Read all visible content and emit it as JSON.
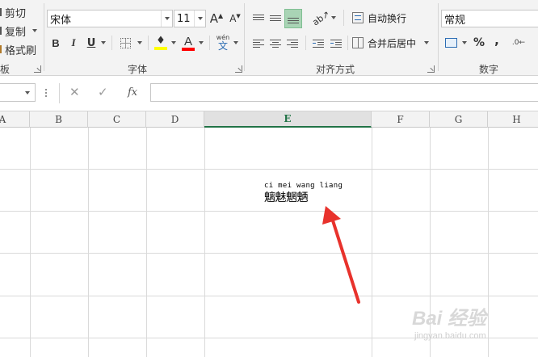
{
  "clipboard": {
    "cut_label": "剪切",
    "copy_label": "复制",
    "format_painter_label": "格式刷",
    "group_label": "板"
  },
  "font": {
    "name": "宋体",
    "size": "11",
    "bold": "B",
    "italic": "I",
    "underline": "U",
    "pinyin_top": "wén",
    "pinyin_bottom": "文",
    "font_color_glyph": "A",
    "fill_color": "#FFFF00",
    "font_color": "#FF0000",
    "group_label": "字体"
  },
  "alignment": {
    "wrap_text_label": "自动换行",
    "merge_center_label": "合并后居中",
    "group_label": "对齐方式"
  },
  "number": {
    "format_value": "常规",
    "percent_label": "%",
    "comma_label": ",",
    "group_label": "数字"
  },
  "formula_bar": {
    "fx_label": "fx"
  },
  "columns": [
    "A",
    "B",
    "C",
    "D",
    "E",
    "F",
    "G",
    "H"
  ],
  "active_column": "E",
  "cell": {
    "pinyin": "ci mei wang liang",
    "characters": "魑魅魍魉"
  },
  "watermark": {
    "brand": "Bai 经验",
    "url": "jingyan.baidu.com"
  },
  "colors": {
    "accent_green": "#217346",
    "arrow_red": "#E8322C"
  }
}
